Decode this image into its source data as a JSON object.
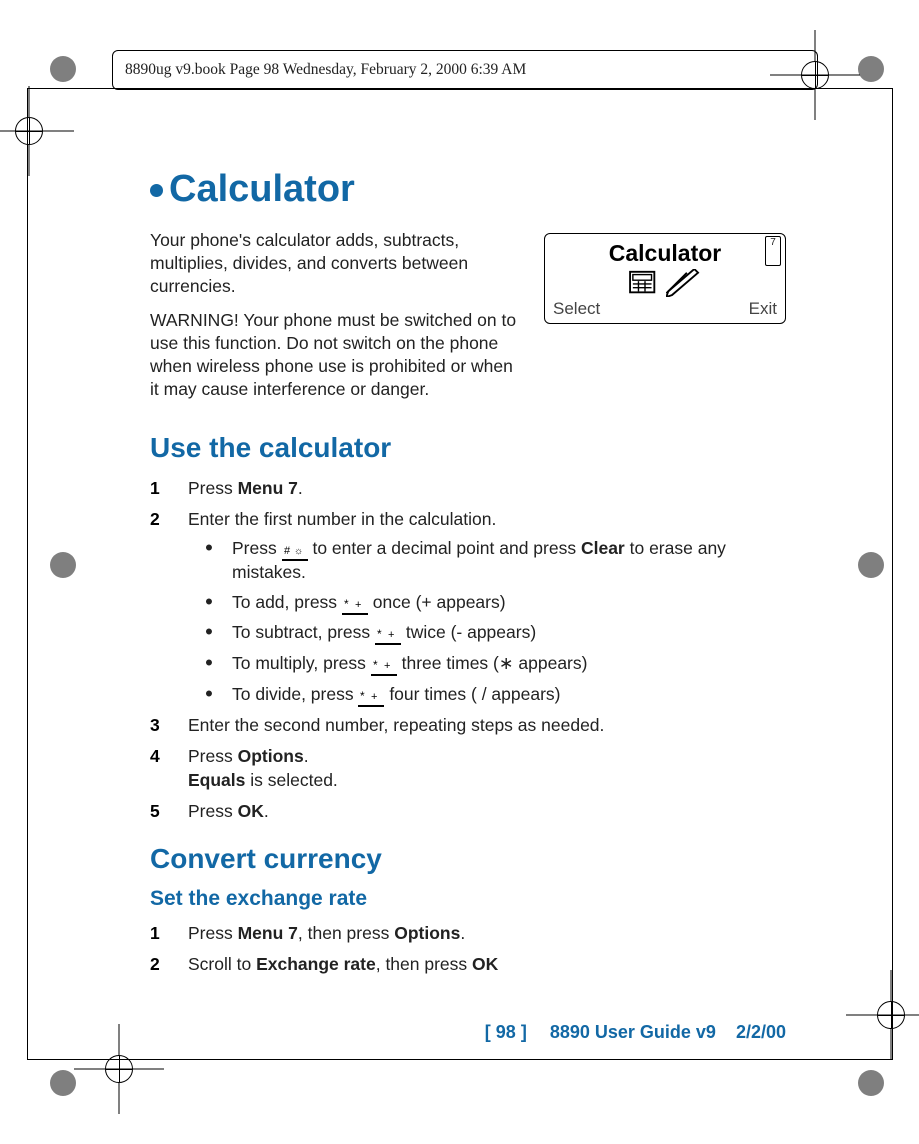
{
  "header": "8890ug v9.book  Page 98  Wednesday, February 2, 2000  6:39 AM",
  "title": "Calculator",
  "intro1": "Your phone's calculator adds, subtracts, multiplies, divides, and converts between currencies.",
  "intro2": "WARNING! Your phone must be switched on to use this function. Do not switch on the phone when wireless phone use is prohibited or when it may cause interference or danger.",
  "thumb": {
    "title": "Calculator",
    "soft_left": "Select",
    "soft_right": "Exit",
    "tab": "7"
  },
  "section1": "Use the calculator",
  "s1": {
    "n1_a": "Press ",
    "n1_b": "Menu 7",
    "n1_c": ".",
    "n2": "Enter the first number in the calculation.",
    "sb1_a": "Press ",
    "sb1_b": " to enter a decimal point and press ",
    "sb1_c": "Clear",
    "sb1_d": " to erase any mistakes.",
    "sb2_a": "To add, press ",
    "sb2_b": " once (+ appears)",
    "sb3_a": "To subtract, press ",
    "sb3_b": " twice (- appears)",
    "sb4_a": "To multiply, press ",
    "sb4_b": " three times  (∗ appears)",
    "sb5_a": "To divide, press ",
    "sb5_b": " four times ( / appears)",
    "n3": "Enter the second number, repeating steps as needed.",
    "n4_a": "Press ",
    "n4_b": "Options",
    "n4_c": ".",
    "n4_d": "Equals",
    "n4_e": " is selected.",
    "n5_a": "Press ",
    "n5_b": "OK",
    "n5_c": "."
  },
  "section2": "Convert currency",
  "sub2": "Set the exchange rate",
  "s2": {
    "n1_a": "Press ",
    "n1_b": "Menu 7",
    "n1_c": ", then press ",
    "n1_d": "Options",
    "n1_e": ".",
    "n2_a": "Scroll to ",
    "n2_b": "Exchange rate",
    "n2_c": ", then press ",
    "n2_d": "OK"
  },
  "footer": {
    "page_label": "[ 98 ]",
    "doc": "8890 User Guide v9",
    "date": "2/2/00"
  }
}
